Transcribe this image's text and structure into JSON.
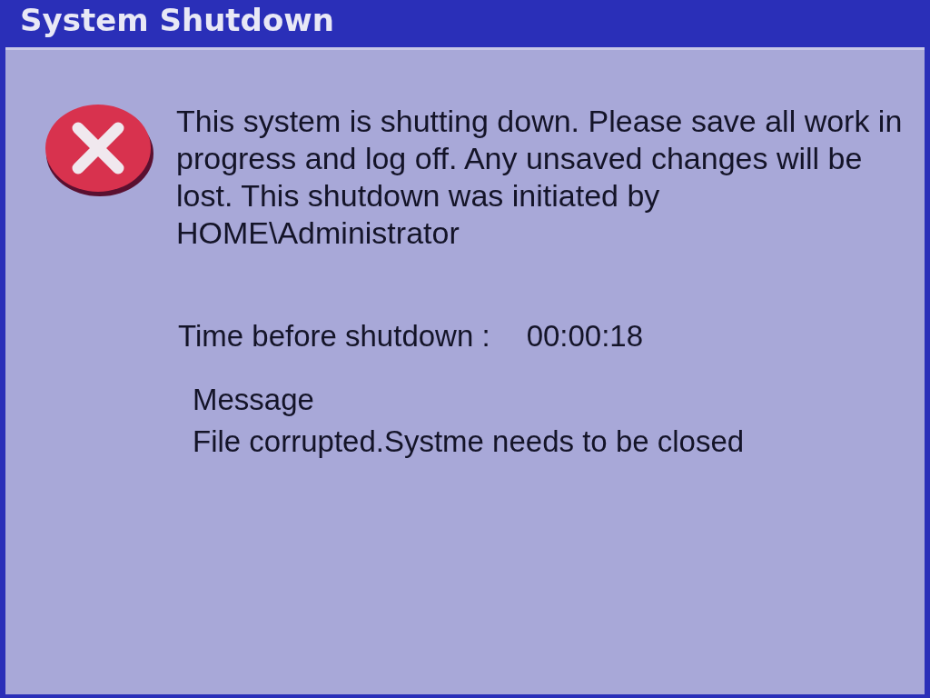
{
  "window": {
    "title": "System Shutdown"
  },
  "notice": "This system is shutting down. Please save all work in progress and log off. Any unsaved changes will be lost. This shutdown was initiated by HOME\\Administrator",
  "countdown": {
    "label": "Time before shutdown :",
    "value": "00:00:18"
  },
  "message": {
    "label": "Message",
    "text": "File corrupted.Systme needs to be closed"
  }
}
